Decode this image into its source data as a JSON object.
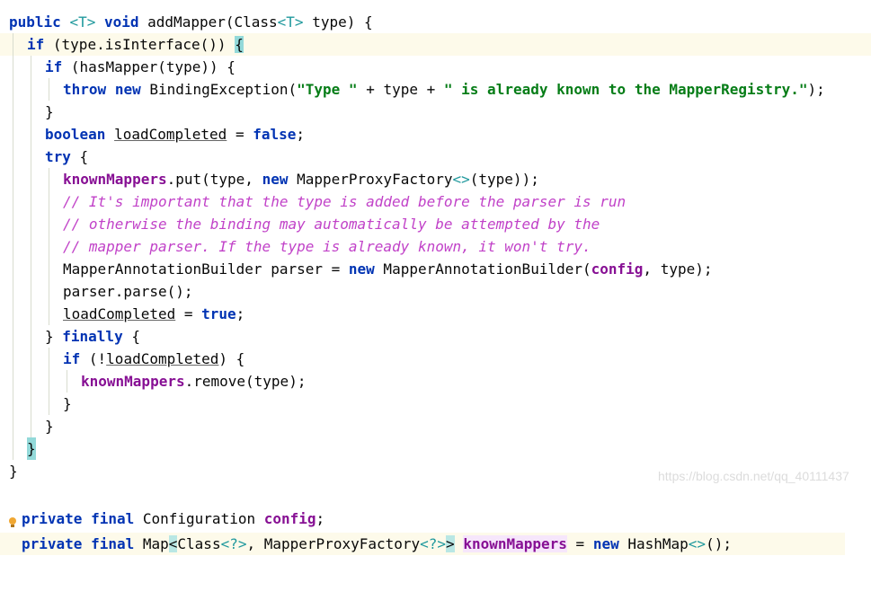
{
  "code_lines": [
    {
      "t1": "public",
      "t2": "<T>",
      "t3": "void",
      "t4": "addMapper(Class",
      "t5": "<T>",
      "t6": "type) {"
    },
    {
      "kw": "if",
      "rest": "(type.isInterface())",
      "brace": "{"
    },
    {
      "kw": "if",
      "rest": "(hasMapper(type)) {"
    },
    {
      "kw1": "throw",
      "kw2": "new",
      "call": "BindingException(",
      "str1": "\"Type \"",
      "mid": " + type + ",
      "str2": "\" is already known to the MapperRegistry.\"",
      "end": ");"
    },
    {
      "text": "}"
    },
    {
      "kw": "boolean",
      "var": "loadCompleted",
      "eq": " = ",
      "val": "false",
      "end": ";"
    },
    {
      "kw": "try",
      "rest": " {"
    },
    {
      "field": "knownMappers",
      "mid": ".put(type, ",
      "kw": "new",
      "cls": " MapperProxyFactory",
      "gen": "<>",
      "end": "(type));"
    },
    {
      "comment": "// It's important that the type is added before the parser is run"
    },
    {
      "comment": "// otherwise the binding may automatically be attempted by the"
    },
    {
      "comment": "// mapper parser. If the type is already known, it won't try."
    },
    {
      "a": "MapperAnnotationBuilder parser = ",
      "kw": "new",
      "b": " MapperAnnotationBuilder(",
      "field": "config",
      "c": ", type);"
    },
    {
      "text": "parser.parse();"
    },
    {
      "var": "loadCompleted",
      "eq": " = ",
      "val": "true",
      "end": ";"
    },
    {
      "a": "} ",
      "kw": "finally",
      "b": " {"
    },
    {
      "kw": "if",
      "a": " (!",
      "var": "loadCompleted",
      "b": ") {"
    },
    {
      "field": "knownMappers",
      "rest": ".remove(type);"
    },
    {
      "text": "}"
    },
    {
      "text": "}"
    },
    {
      "text": "}"
    },
    {
      "text": "}"
    }
  ],
  "fields": {
    "config_line": {
      "kw": "private final",
      "type": " Configuration ",
      "name": "config",
      "end": ";"
    },
    "mappers_line": {
      "kw": "private final",
      "a": " Map",
      "lt": "<",
      "b": "Class",
      "gen1": "<?>",
      "c": ", MapperProxyFactory",
      "gen2": "<?>",
      "gt": ">",
      "sp": " ",
      "name": "knownMappers",
      "eq": " = ",
      "kw2": "new",
      "d": " HashMap",
      "gen3": "<>",
      "e": "();"
    }
  },
  "watermark": "https://blog.csdn.net/qq_40111437",
  "icons": {
    "intention": "lightbulb-icon"
  },
  "colors": {
    "keyword": "#0033b3",
    "string": "#067d17",
    "field": "#871094",
    "comment": "#c142c8",
    "highlight": "#fdfaea"
  }
}
